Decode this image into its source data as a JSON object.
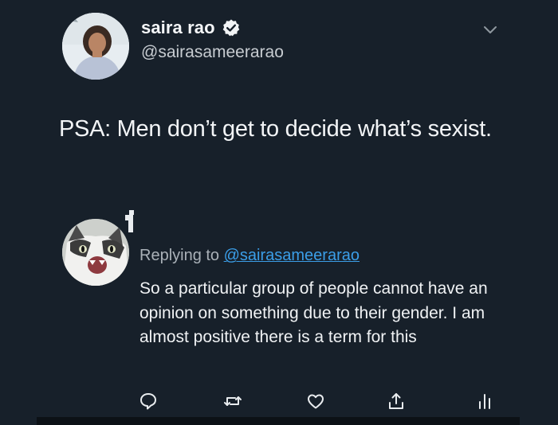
{
  "tweet": {
    "author": {
      "display_name": "saira rao",
      "handle": "@sairasameerarao",
      "verified": true
    },
    "text": "PSA: Men don’t get to decide what’s sexist."
  },
  "reply": {
    "replying_to_label": "Replying to",
    "replying_to_handle": "@sairasameerarao",
    "text": "So a particular group of people cannot have an opinion on something due to their gender. I am almost positive there is a term for this"
  },
  "actions": {
    "icons": [
      "reply-icon",
      "retweet-icon",
      "like-icon",
      "share-icon",
      "analytics-icon"
    ]
  },
  "colors": {
    "background": "#17202a",
    "link": "#3b9ee8",
    "text": "#f2f4f6",
    "muted": "#aab1b8"
  }
}
